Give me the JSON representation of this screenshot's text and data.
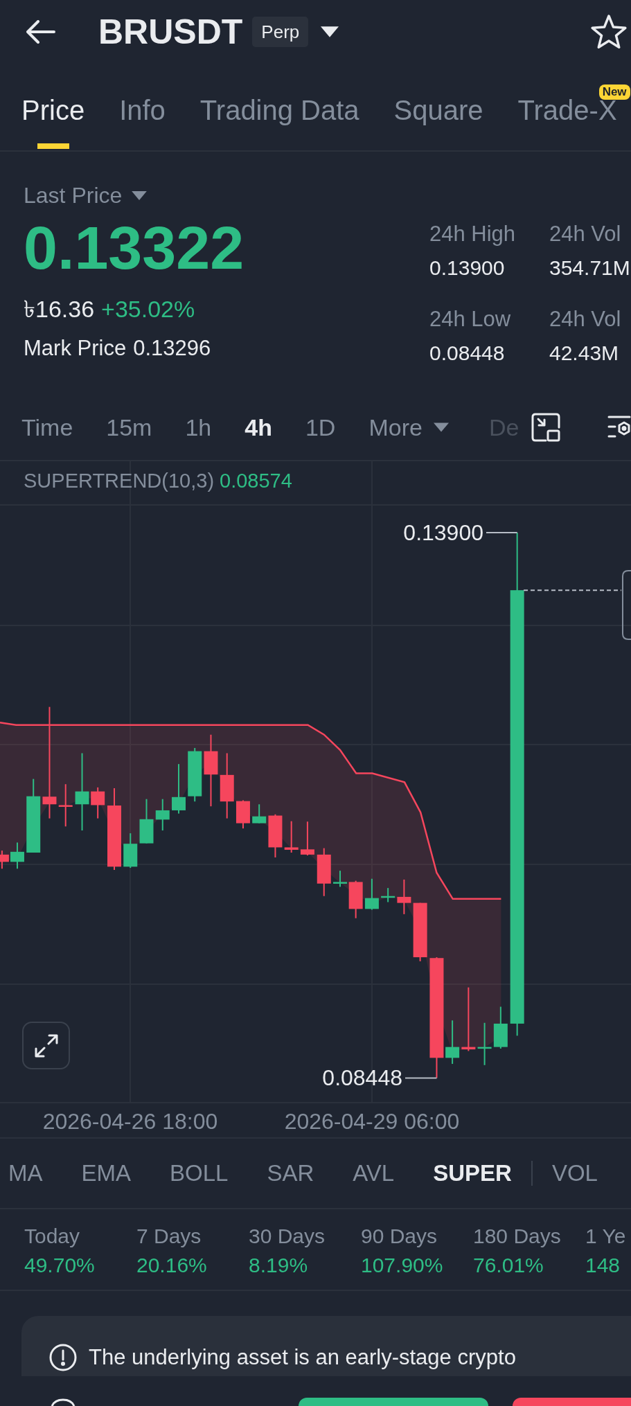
{
  "header": {
    "symbol": "BRUSDT",
    "badge": "Perp"
  },
  "tabs": [
    {
      "label": "Price",
      "selected": true
    },
    {
      "label": "Info",
      "selected": false
    },
    {
      "label": "Trading Data",
      "selected": false
    },
    {
      "label": "Square",
      "selected": false
    },
    {
      "label": "Trade-X",
      "selected": false,
      "badge": "New"
    }
  ],
  "price": {
    "label": "Last Price",
    "last": "0.13322",
    "fiat": "৳16.36",
    "change": "+35.02%",
    "mark_label": "Mark Price",
    "mark": "0.13296"
  },
  "stats": [
    {
      "label": "24h High",
      "value": "0.13900"
    },
    {
      "label": "24h Vol",
      "value": "354.71M"
    },
    {
      "label": "24h Low",
      "value": "0.08448"
    },
    {
      "label": "24h Vol",
      "value": "42.43M"
    }
  ],
  "intervals": [
    {
      "label": "Time",
      "selected": false
    },
    {
      "label": "15m",
      "selected": false
    },
    {
      "label": "1h",
      "selected": false
    },
    {
      "label": "4h",
      "selected": true
    },
    {
      "label": "1D",
      "selected": false
    }
  ],
  "more": {
    "label": "More"
  },
  "depth_tab": {
    "label": "De"
  },
  "chart": {
    "legend": {
      "name": "SUPERTREND(10,3)",
      "value": "0.08574"
    },
    "high_label": "0.13900",
    "low_label": "0.08448",
    "time_labels": [
      "2026-04-26 18:00",
      "2026-04-29 06:00"
    ]
  },
  "indicators": [
    {
      "label": "MA",
      "selected": false
    },
    {
      "label": "EMA",
      "selected": false
    },
    {
      "label": "BOLL",
      "selected": false
    },
    {
      "label": "SAR",
      "selected": false
    },
    {
      "label": "AVL",
      "selected": false
    },
    {
      "label": "SUPER",
      "selected": true
    }
  ],
  "sub_indicators": [
    {
      "label": "VOL",
      "selected": false
    }
  ],
  "returns": [
    {
      "period": "Today",
      "change": "49.70%"
    },
    {
      "period": "7 Days",
      "change": "20.16%"
    },
    {
      "period": "30 Days",
      "change": "8.19%"
    },
    {
      "period": "90 Days",
      "change": "107.90%"
    },
    {
      "period": "180 Days",
      "change": "76.01%"
    },
    {
      "period": "1 Ye",
      "change": "148"
    }
  ],
  "notice": {
    "text": "The underlying asset is an early-stage crypto"
  }
}
